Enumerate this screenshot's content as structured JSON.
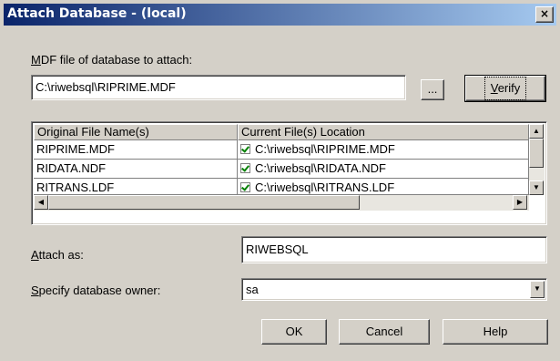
{
  "window": {
    "title": "Attach Database - (local)",
    "close_glyph": "×"
  },
  "mdf": {
    "label_accel": "M",
    "label_rest": "DF file of database to attach:",
    "value": "C:\\riwebsql\\RIPRIME.MDF",
    "browse_label": "...",
    "verify_accel": "V",
    "verify_rest": "erify"
  },
  "files_grid": {
    "columns": [
      "Original File Name(s)",
      "Current File(s) Location"
    ],
    "rows": [
      {
        "original": "RIPRIME.MDF",
        "checked": true,
        "location": "C:\\riwebsql\\RIPRIME.MDF"
      },
      {
        "original": "RIDATA.NDF",
        "checked": true,
        "location": "C:\\riwebsql\\RIDATA.NDF"
      },
      {
        "original": "RITRANS.LDF",
        "checked": true,
        "location": "C:\\riwebsql\\RITRANS.LDF"
      }
    ]
  },
  "attach_as": {
    "label_accel": "A",
    "label_rest": "ttach as:",
    "value": "RIWEBSQL"
  },
  "owner": {
    "label_accel": "S",
    "label_rest": "pecify database owner:",
    "value": "sa"
  },
  "buttons": {
    "ok": "OK",
    "cancel": "Cancel",
    "help": "Help"
  },
  "icons": {
    "close": "close-icon",
    "check": "check-icon",
    "scroll_up": "scroll-up-arrow-icon",
    "scroll_down": "scroll-down-arrow-icon",
    "scroll_left": "scroll-left-arrow-icon",
    "scroll_right": "scroll-right-arrow-icon",
    "dropdown": "chevron-down-icon"
  },
  "colors": {
    "titlebar_start": "#0a246a",
    "titlebar_end": "#a6caf0",
    "dialog_bg": "#d4d0c8",
    "check_color": "#008000"
  }
}
